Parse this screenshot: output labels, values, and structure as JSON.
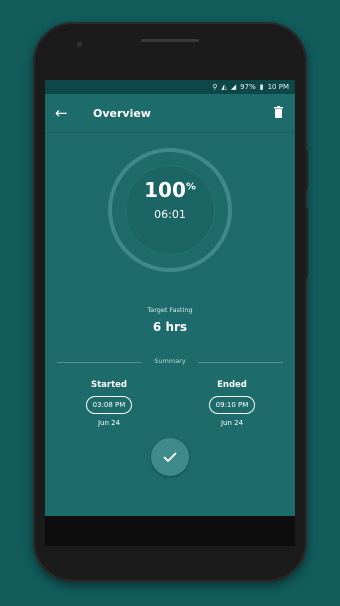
{
  "status_bar": {
    "battery": "97%",
    "time": "10 PM"
  },
  "appbar": {
    "title": "Overview"
  },
  "progress": {
    "percent_value": "100",
    "percent_sign": "%",
    "elapsed": "06:01"
  },
  "target": {
    "label": "Target Fasting",
    "value": "6 hrs"
  },
  "summary": {
    "label": "Summary",
    "started": {
      "title": "Started",
      "time": "03:08 PM",
      "date": "Jun 24"
    },
    "ended": {
      "title": "Ended",
      "time": "09:10 PM",
      "date": "Jun 24"
    }
  },
  "icons": {
    "back": "arrow-left-icon",
    "delete": "trash-icon",
    "confirm": "check-icon"
  },
  "colors": {
    "background": "#125c5c",
    "app_bar": "#1d6b6b",
    "screen": "#1e6b6b",
    "accent": "#3f8a8a"
  }
}
